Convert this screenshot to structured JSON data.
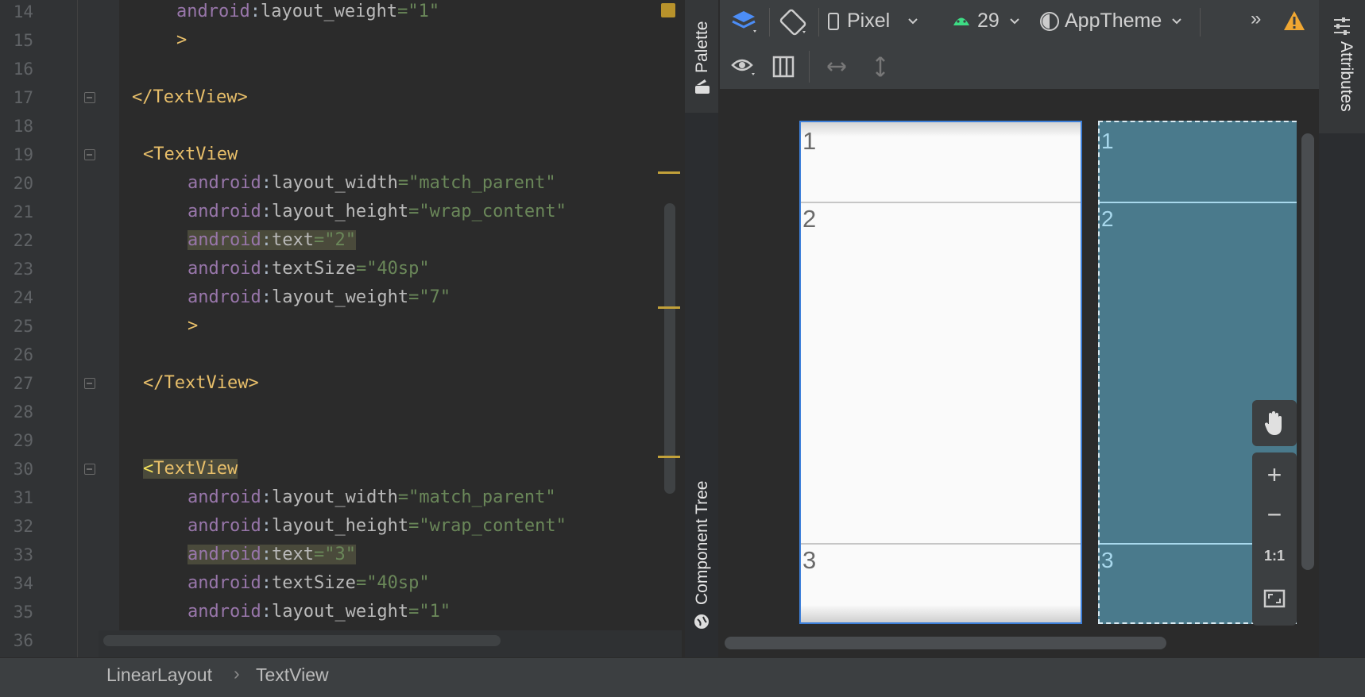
{
  "editor": {
    "lines": [
      {
        "num": "14"
      },
      {
        "num": "15"
      },
      {
        "num": "16"
      },
      {
        "num": "17"
      },
      {
        "num": "18"
      },
      {
        "num": "19"
      },
      {
        "num": "20"
      },
      {
        "num": "21"
      },
      {
        "num": "22"
      },
      {
        "num": "23"
      },
      {
        "num": "24"
      },
      {
        "num": "25"
      },
      {
        "num": "26"
      },
      {
        "num": "27"
      },
      {
        "num": "28"
      },
      {
        "num": "29"
      },
      {
        "num": "30"
      },
      {
        "num": "31"
      },
      {
        "num": "32"
      },
      {
        "num": "33"
      },
      {
        "num": "34"
      },
      {
        "num": "35"
      },
      {
        "num": "36"
      }
    ],
    "code": {
      "l14": {
        "ns": "android",
        "sep": ":",
        "attr": "layout_weight",
        "eq": "=",
        "val": "\"1\""
      },
      "l15": ">",
      "l17": "</TextView>",
      "l19": "<TextView",
      "l20": {
        "ns": "android",
        "sep": ":",
        "attr": "layout_width",
        "eq": "=",
        "val": "\"match_parent\""
      },
      "l21": {
        "ns": "android",
        "sep": ":",
        "attr": "layout_height",
        "eq": "=",
        "val": "\"wrap_content\""
      },
      "l22": {
        "ns": "android",
        "sep": ":",
        "attr": "text",
        "eq": "=",
        "val": "\"2\""
      },
      "l23": {
        "ns": "android",
        "sep": ":",
        "attr": "textSize",
        "eq": "=",
        "val": "\"40sp\""
      },
      "l24": {
        "ns": "android",
        "sep": ":",
        "attr": "layout_weight",
        "eq": "=",
        "val": "\"7\""
      },
      "l25": ">",
      "l27": "</TextView>",
      "l30a": "<",
      "l30b": "TextView",
      "l31": {
        "ns": "android",
        "sep": ":",
        "attr": "layout_width",
        "eq": "=",
        "val": "\"match_parent\""
      },
      "l32": {
        "ns": "android",
        "sep": ":",
        "attr": "layout_height",
        "eq": "=",
        "val": "\"wrap_content\""
      },
      "l33": {
        "ns": "android",
        "sep": ":",
        "attr": "text",
        "eq": "=",
        "val": "\"3\""
      },
      "l34": {
        "ns": "android",
        "sep": ":",
        "attr": "textSize",
        "eq": "=",
        "val": "\"40sp\""
      },
      "l35": {
        "ns": "android",
        "sep": ":",
        "attr": "layout_weight",
        "eq": "=",
        "val": "\"1\""
      }
    }
  },
  "side_tabs": {
    "palette": "Palette",
    "component_tree": "Component Tree",
    "attributes": "Attributes"
  },
  "toolbar": {
    "device": "Pixel",
    "api": "29",
    "theme": "AppTheme",
    "more": "»"
  },
  "preview": {
    "design": [
      "1",
      "2",
      "3"
    ],
    "blueprint": [
      "1",
      "2",
      "3"
    ]
  },
  "zoom": {
    "plus": "+",
    "minus": "−",
    "one_to_one": "1:1"
  },
  "breadcrumb": {
    "root": "LinearLayout",
    "sep": "›",
    "child": "TextView"
  },
  "colors": {
    "accent": "#3d7fd9",
    "blueprint": "#4a7a8c",
    "warning": "#f0a732"
  }
}
